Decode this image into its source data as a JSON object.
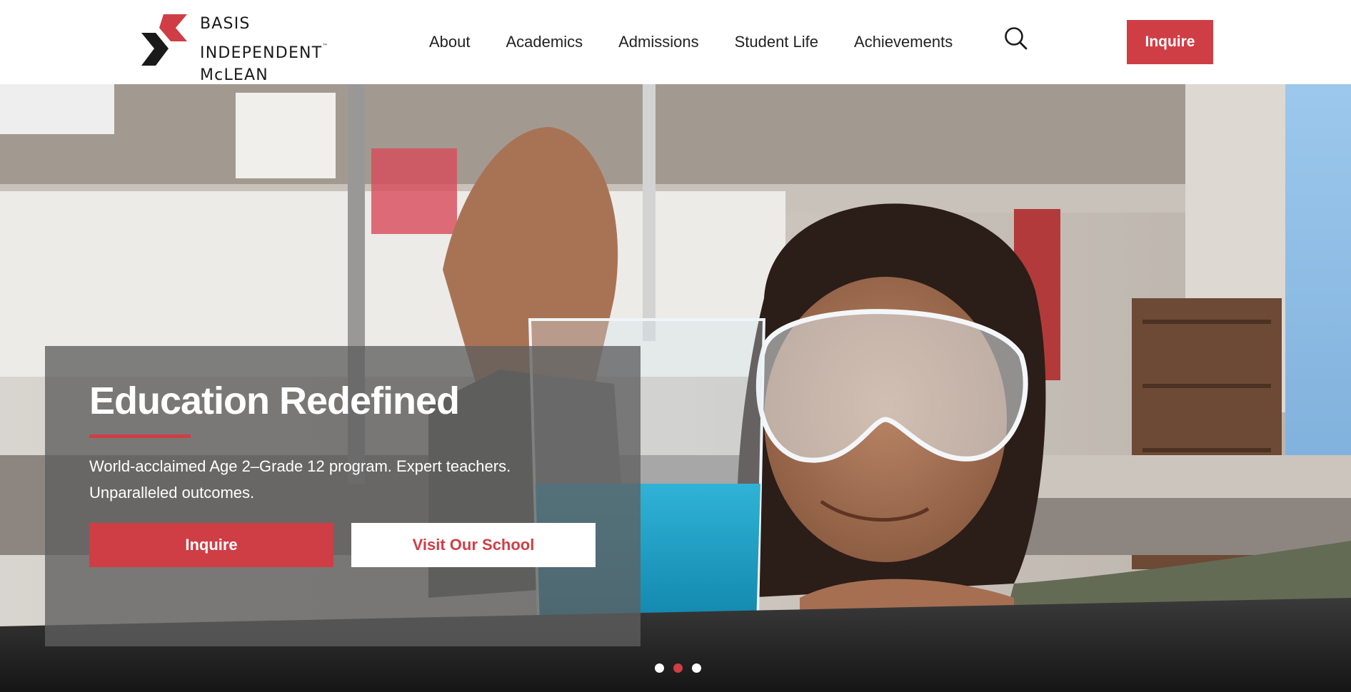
{
  "brand": {
    "line1": "BASIS",
    "line2": "INDEPENDENT",
    "trademark": "™",
    "line3": "McLEAN",
    "colors": {
      "accent": "#cf3e45",
      "dark": "#1a1a1a"
    }
  },
  "nav": {
    "items": [
      {
        "label": "About"
      },
      {
        "label": "Academics"
      },
      {
        "label": "Admissions"
      },
      {
        "label": "Student Life"
      },
      {
        "label": "Achievements"
      }
    ],
    "search_icon": "search-icon",
    "inquire_label": "Inquire"
  },
  "hero": {
    "title": "Education Redefined",
    "subtitle_line1": "World-acclaimed Age 2–Grade 12 program. Expert teachers.",
    "subtitle_line2": "Unparalleled outcomes.",
    "primary_cta": "Inquire",
    "secondary_cta": "Visit Our School",
    "image_description": "student-with-safety-goggles-in-science-lab",
    "carousel": {
      "slides": 3,
      "active_index": 1
    }
  }
}
